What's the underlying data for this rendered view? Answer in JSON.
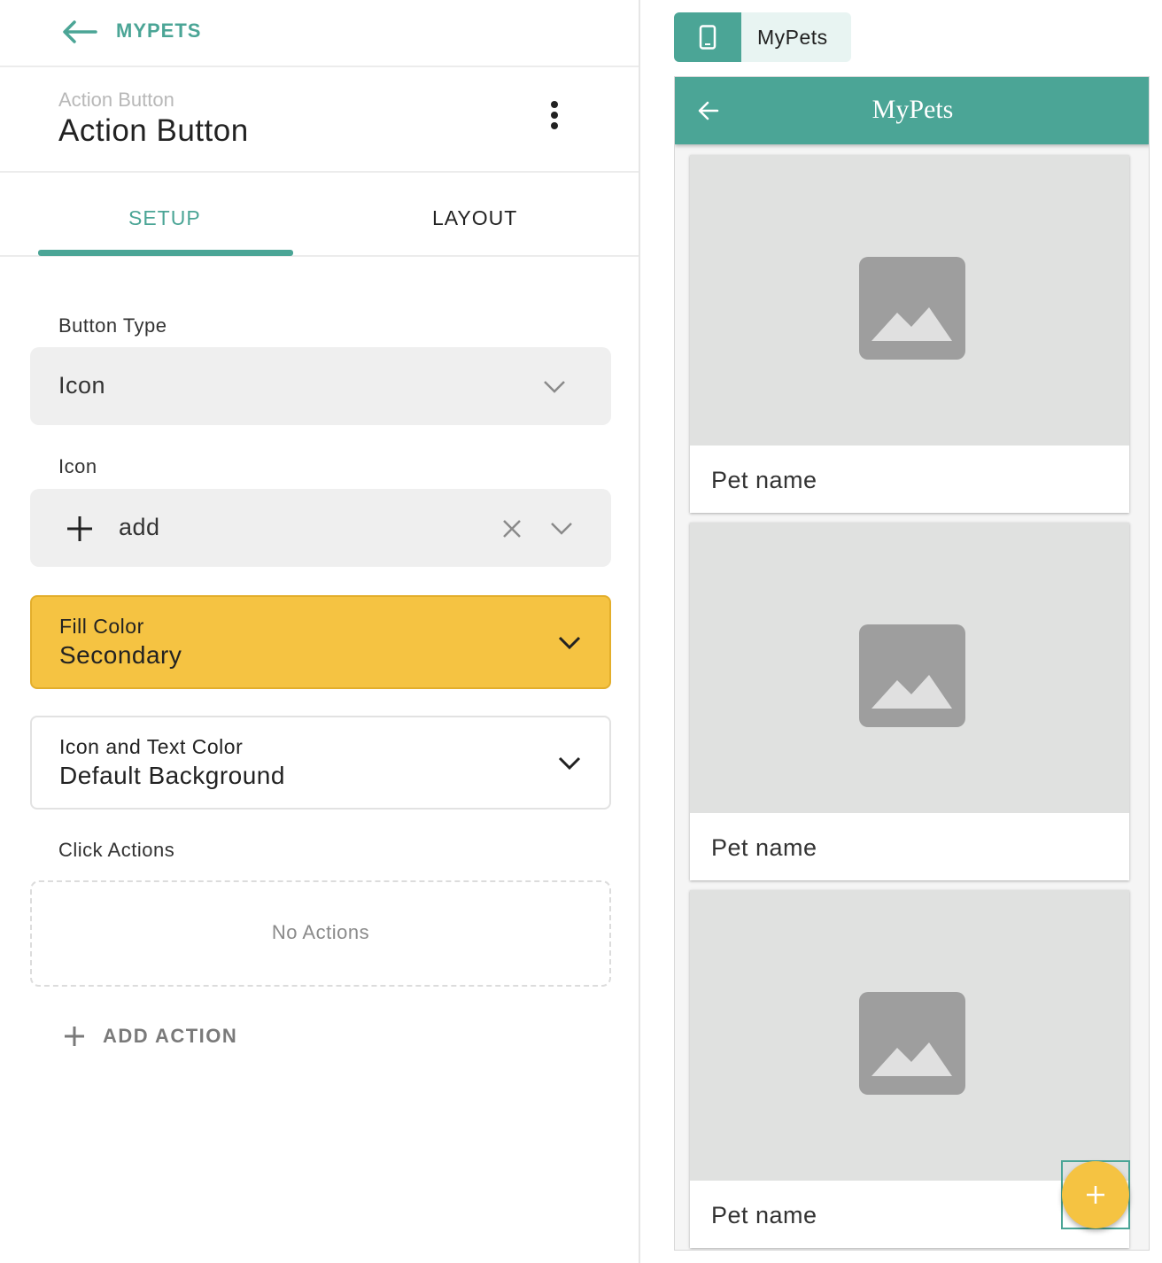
{
  "nav": {
    "back_label": "MYPETS"
  },
  "header": {
    "subtitle": "Action Button",
    "title": "Action Button"
  },
  "tabs": [
    {
      "label": "SETUP",
      "active": true
    },
    {
      "label": "LAYOUT",
      "active": false
    }
  ],
  "form": {
    "button_type": {
      "label": "Button Type",
      "value": "Icon"
    },
    "icon": {
      "label": "Icon",
      "value": "add",
      "icon_name": "plus-icon"
    },
    "fill_color": {
      "label": "Fill Color",
      "value": "Secondary",
      "color": "#f5c342"
    },
    "icon_text_color": {
      "label": "Icon and Text Color",
      "value": "Default Background"
    },
    "click_actions": {
      "label": "Click Actions",
      "empty_text": "No Actions",
      "add_label": "ADD ACTION"
    }
  },
  "preview": {
    "device_label": "MyPets",
    "app_title": "MyPets",
    "accent_color": "#4ba596",
    "cards": [
      {
        "title": "Pet name"
      },
      {
        "title": "Pet name"
      },
      {
        "title": "Pet name"
      }
    ],
    "fab_icon": "plus-icon"
  }
}
